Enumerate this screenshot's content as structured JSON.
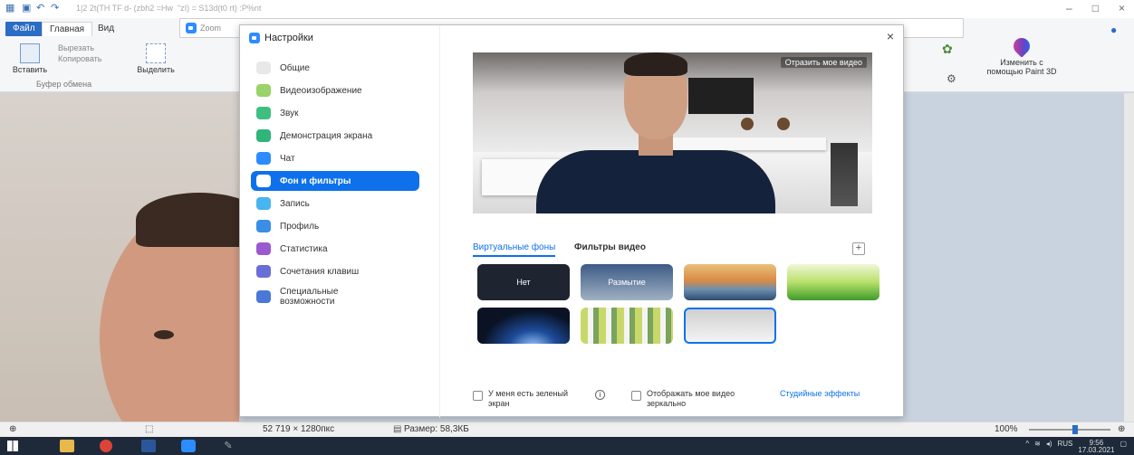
{
  "paint": {
    "titlebar_path": "1|2 2t(TH TF d- (zbh2 =Hw  \"zI) = S13d(t0 rt) :P%nt",
    "tabs": [
      "Файл",
      "Главная",
      "Вид"
    ],
    "ribbon": {
      "paste_label": "Вставить",
      "cut_label": "Вырезать",
      "copy_label": "Копировать",
      "select_label": "Выделить",
      "clipboard_group": "Буфер обмена",
      "paint3d_label": "Изменить с помощью Paint 3D"
    },
    "status": {
      "dimensions": "52 719 × 1280пкс",
      "size": "Размер: 58,3КБ",
      "zoom": "100%"
    }
  },
  "zoom_window_title": "Zoom",
  "settings": {
    "title": "Настройки",
    "close": "×",
    "nav": [
      {
        "label": "Общие",
        "color": "#e8e8e8"
      },
      {
        "label": "Видеоизображение",
        "color": "#9ad36a"
      },
      {
        "label": "Звук",
        "color": "#3fbf7f"
      },
      {
        "label": "Демонстрация экрана",
        "color": "#2fb57a"
      },
      {
        "label": "Чат",
        "color": "#2d8cff"
      },
      {
        "label": "Фон и фильтры",
        "color": "#ffffff"
      },
      {
        "label": "Запись",
        "color": "#48b4f0"
      },
      {
        "label": "Профиль",
        "color": "#3a8ee6"
      },
      {
        "label": "Статистика",
        "color": "#9b59d0"
      },
      {
        "label": "Сочетания клавиш",
        "color": "#6a6fd8"
      },
      {
        "label": "Специальные возможности",
        "color": "#4a78d8"
      }
    ],
    "active_nav_index": 5,
    "mirror_badge": "Отразить мое видео",
    "tabs": [
      "Виртуальные фоны",
      "Фильтры видео"
    ],
    "add_label": "+",
    "thumbs": [
      {
        "kind": "none",
        "label": "Нет"
      },
      {
        "kind": "blur",
        "label": "Размытие"
      },
      {
        "kind": "bridge",
        "label": ""
      },
      {
        "kind": "grass",
        "label": ""
      },
      {
        "kind": "space",
        "label": ""
      },
      {
        "kind": "office",
        "label": ""
      },
      {
        "kind": "room",
        "label": ""
      }
    ],
    "green_screen_label": "У меня есть зеленый экран",
    "mirror_label": "Отображать мое видео зеркально",
    "studio_effects": "Студийные эффекты",
    "info_icon": "i"
  },
  "taskbar": {
    "time": "9:56",
    "date": "17.03.2021",
    "lang": "RUS"
  },
  "colors": {
    "accent": "#0e71eb",
    "zoom_blue": "#2d8cff"
  }
}
